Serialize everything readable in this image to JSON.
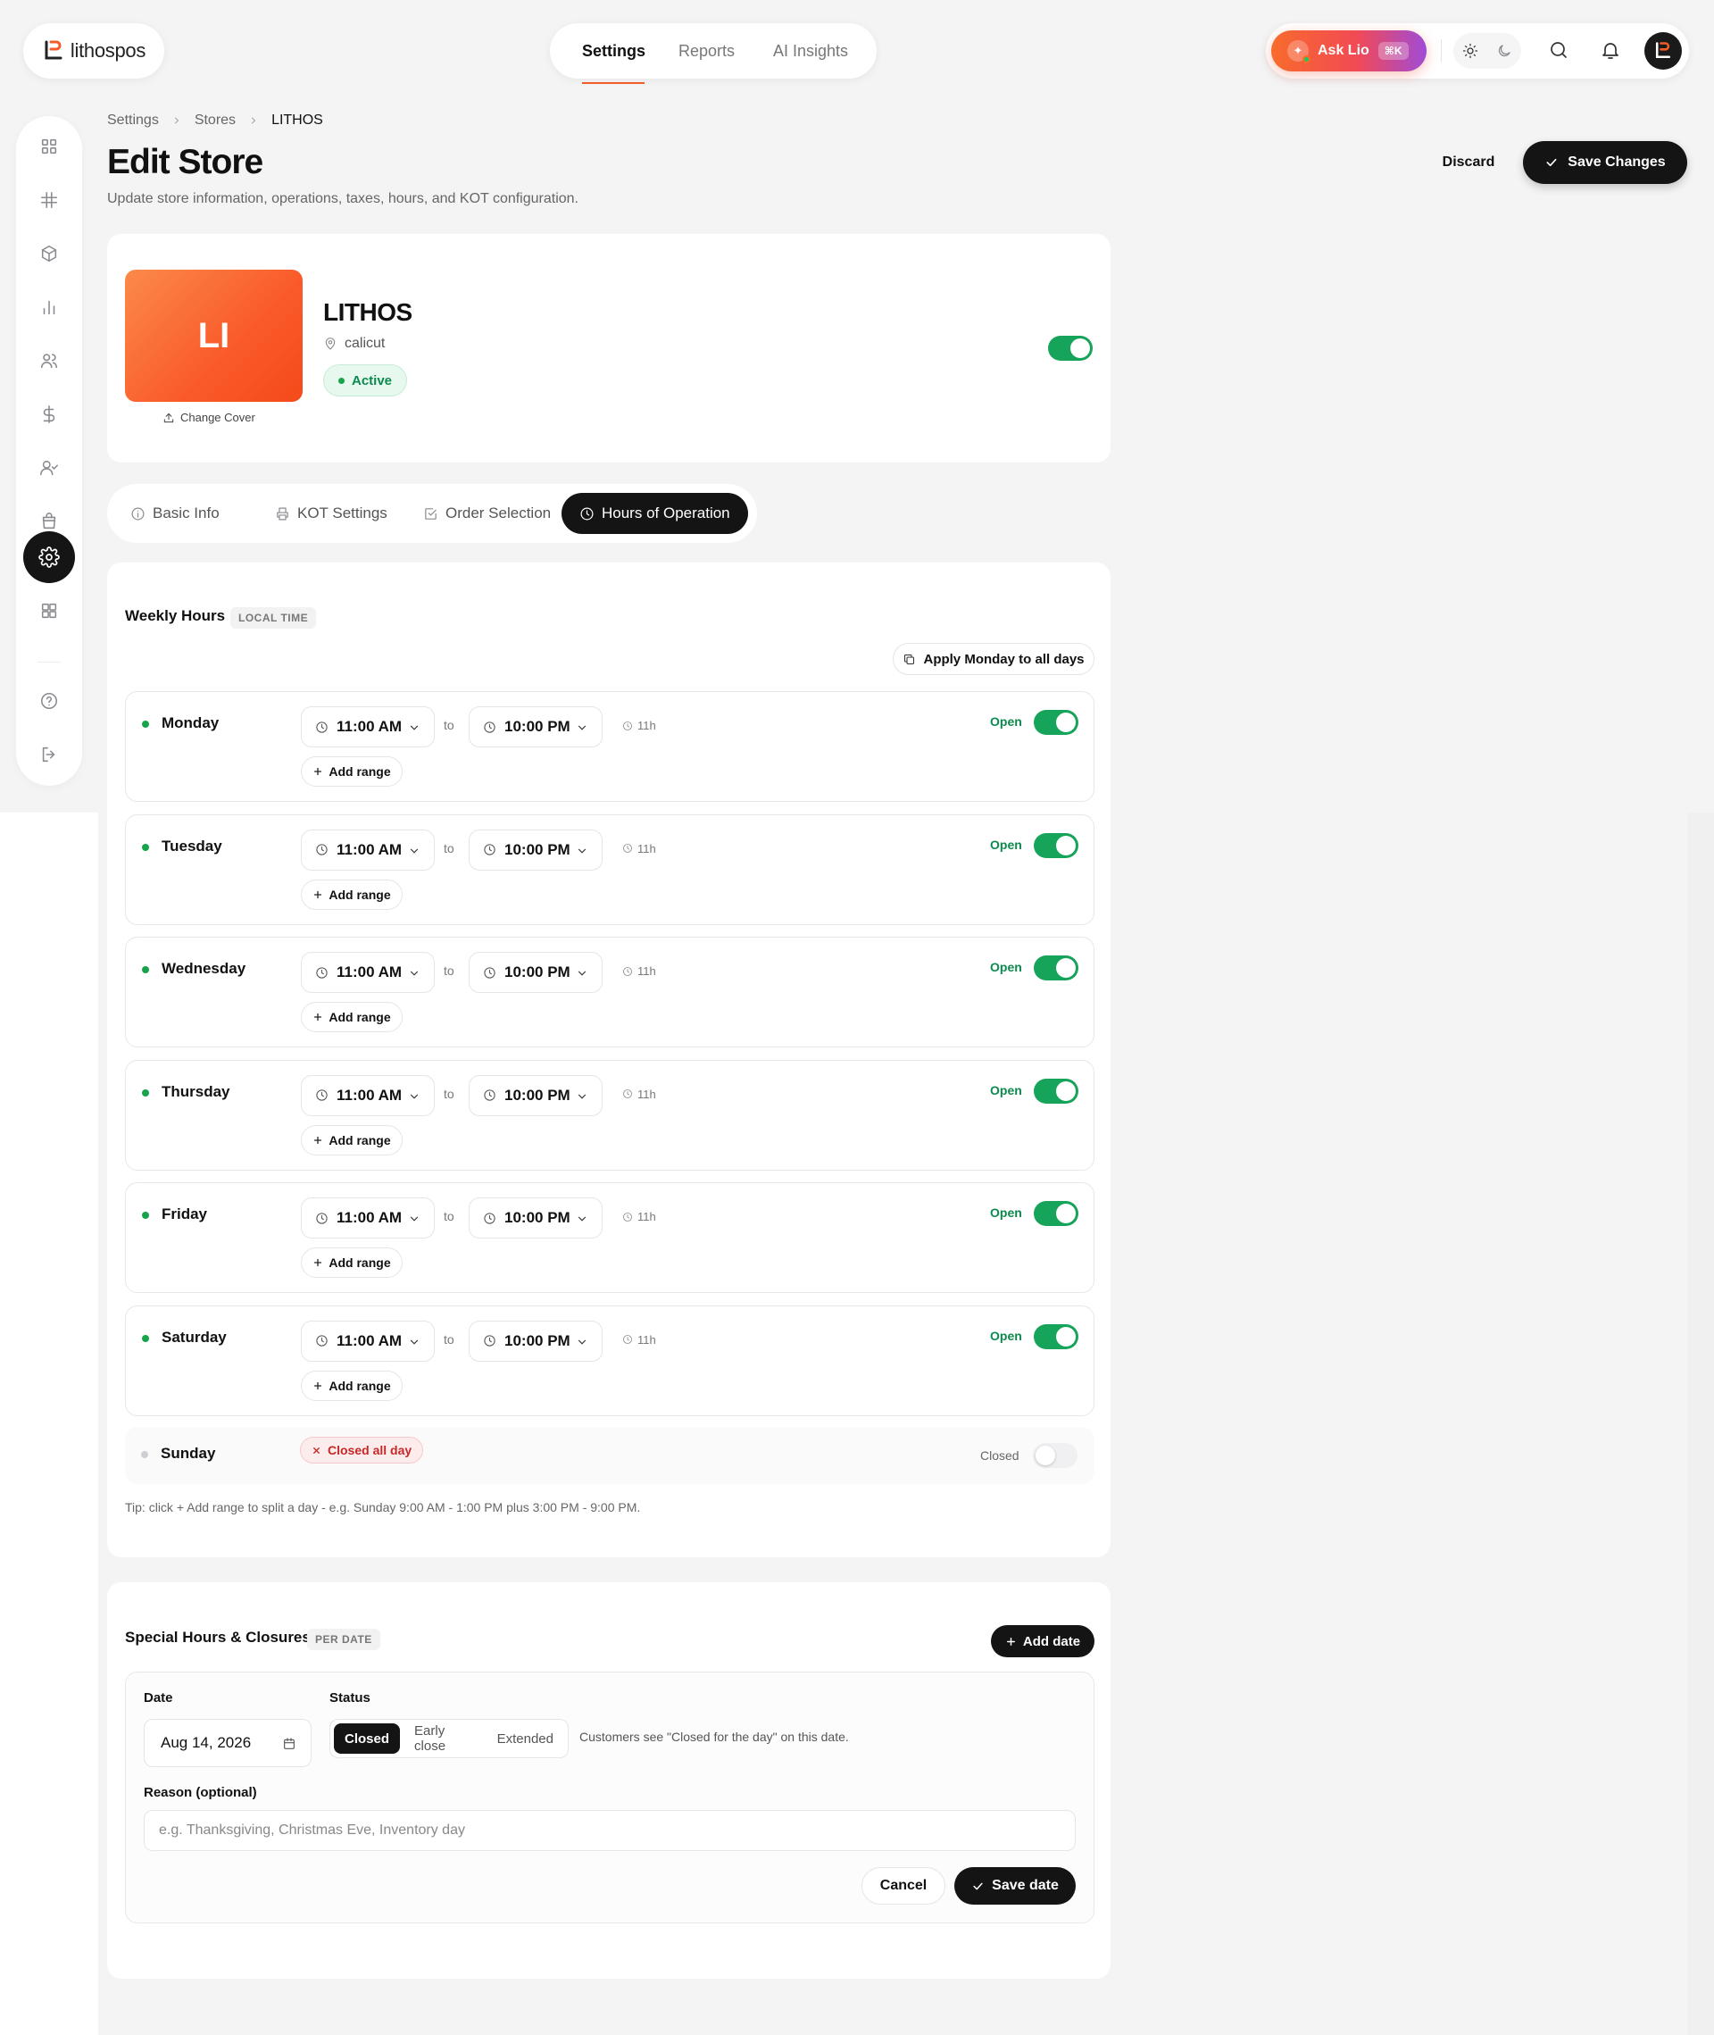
{
  "brand": {
    "name": "lithospos"
  },
  "nav": {
    "tabs": [
      "Settings",
      "Reports",
      "AI Insights"
    ]
  },
  "topbar": {
    "ask_label": "Ask Lio",
    "ask_shortcut": "⌘K"
  },
  "breadcrumb": [
    "Settings",
    "Stores",
    "LITHOS"
  ],
  "page": {
    "title": "Edit Store",
    "subtitle": "Update store information, operations, taxes, hours, and KOT configuration.",
    "discard": "Discard",
    "save": "Save Changes"
  },
  "store": {
    "initials": "LI",
    "name": "LITHOS",
    "location": "calicut",
    "status": "Active",
    "change_cover": "Change Cover",
    "enabled": true
  },
  "tabs": [
    "Basic Info",
    "KOT Settings",
    "Order Selection",
    "Hours of Operation"
  ],
  "weekly": {
    "title": "Weekly Hours",
    "tag": "LOCAL TIME",
    "apply_label": "Apply Monday to all days",
    "to_label": "to",
    "add_range": "Add range",
    "open_label": "Open",
    "closed_label": "Closed",
    "closed_all_day": "Closed all day",
    "days": [
      {
        "name": "Monday",
        "open": "11:00 AM",
        "close": "10:00 PM",
        "duration": "11h"
      },
      {
        "name": "Tuesday",
        "open": "11:00 AM",
        "close": "10:00 PM",
        "duration": "11h"
      },
      {
        "name": "Wednesday",
        "open": "11:00 AM",
        "close": "10:00 PM",
        "duration": "11h"
      },
      {
        "name": "Thursday",
        "open": "11:00 AM",
        "close": "10:00 PM",
        "duration": "11h"
      },
      {
        "name": "Friday",
        "open": "11:00 AM",
        "close": "10:00 PM",
        "duration": "11h"
      },
      {
        "name": "Saturday",
        "open": "11:00 AM",
        "close": "10:00 PM",
        "duration": "11h"
      }
    ],
    "sunday": "Sunday",
    "tip": "Tip: click + Add range to split a day - e.g. Sunday 9:00 AM - 1:00 PM plus 3:00 PM - 9:00 PM."
  },
  "special": {
    "title": "Special Hours & Closures",
    "tag": "PER DATE",
    "add_date": "Add date",
    "date_label": "Date",
    "date_value": "Aug 14, 2026",
    "status_label": "Status",
    "status_options": [
      "Closed",
      "Early close",
      "Extended"
    ],
    "hint": "Customers see \"Closed for the day\" on this date.",
    "reason_label": "Reason (optional)",
    "reason_placeholder": "e.g. Thanksgiving, Christmas Eve, Inventory day",
    "cancel": "Cancel",
    "save": "Save date"
  },
  "colors": {
    "accent": "#f25c2a",
    "primary": "#141414",
    "success": "#16a35a"
  }
}
